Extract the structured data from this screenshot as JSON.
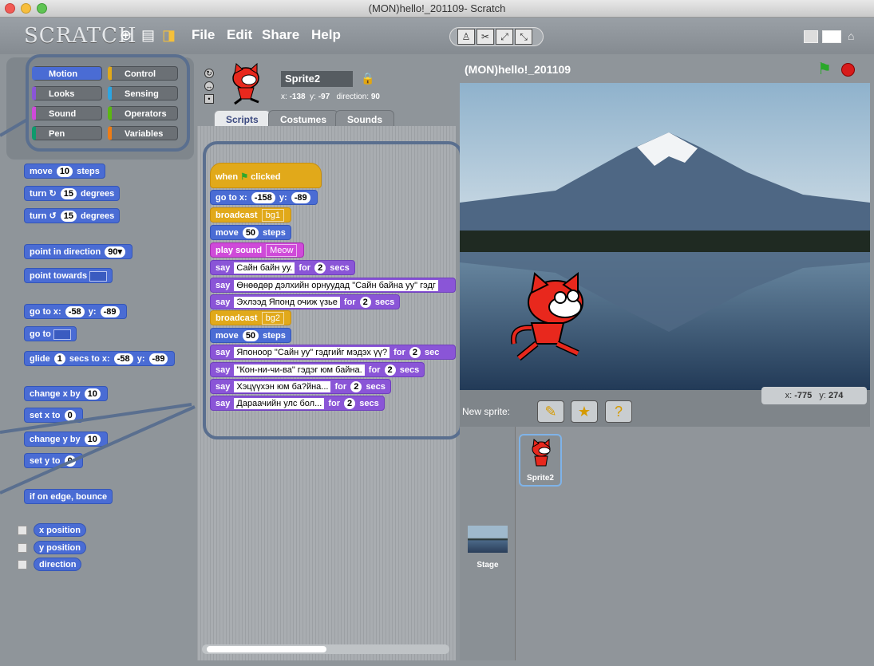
{
  "window": {
    "title": "(MON)hello!_201109- Scratch"
  },
  "menu": {
    "logo": "SCRATCH",
    "items": [
      "File",
      "Edit",
      "Share",
      "Help"
    ]
  },
  "categories": {
    "left": [
      "Motion",
      "Looks",
      "Sound",
      "Pen"
    ],
    "right": [
      "Control",
      "Sensing",
      "Operators",
      "Variables"
    ],
    "colors": {
      "Motion": "#4a6cd4",
      "Looks": "#8a55d7",
      "Sound": "#cf4ad9",
      "Pen": "#0e9a6c",
      "Control": "#e1a91a",
      "Sensing": "#2ca5e2",
      "Operators": "#5cb712",
      "Variables": "#ee7d16"
    }
  },
  "palette": {
    "move": {
      "a": "move",
      "n": "10",
      "b": "steps"
    },
    "turn_cw": {
      "a": "turn ↻",
      "n": "15",
      "b": "degrees"
    },
    "turn_ccw": {
      "a": "turn ↺",
      "n": "15",
      "b": "degrees"
    },
    "point_dir": {
      "a": "point in direction",
      "n": "90▾"
    },
    "point_towards": {
      "a": "point towards"
    },
    "goto_xy": {
      "a": "go to x:",
      "x": "-58",
      "b": "y:",
      "y": "-89"
    },
    "goto": {
      "a": "go to"
    },
    "glide": {
      "a": "glide",
      "s": "1",
      "b": "secs to x:",
      "x": "-58",
      "c": "y:",
      "y": "-89"
    },
    "change_x": {
      "a": "change x by",
      "n": "10"
    },
    "set_x": {
      "a": "set x to",
      "n": "0"
    },
    "change_y": {
      "a": "change y by",
      "n": "10"
    },
    "set_y": {
      "a": "set y to",
      "n": "0"
    },
    "bounce": {
      "a": "if on edge, bounce"
    },
    "reporters": [
      "x position",
      "y position",
      "direction"
    ]
  },
  "sprite": {
    "name": "Sprite2",
    "x_label": "x:",
    "x": "-138",
    "y_label": "y:",
    "y": "-97",
    "dir_label": "direction:",
    "direction": "90"
  },
  "tabs": [
    "Scripts",
    "Costumes",
    "Sounds"
  ],
  "script": {
    "hat": {
      "a": "when",
      "b": "clicked"
    },
    "goto": {
      "a": "go to x:",
      "x": "-158",
      "b": "y:",
      "y": "-89"
    },
    "broadcast1": {
      "a": "broadcast",
      "v": "bg1"
    },
    "move1": {
      "a": "move",
      "n": "50",
      "b": "steps"
    },
    "play": {
      "a": "play sound",
      "v": "Meow"
    },
    "say1": {
      "a": "say",
      "t": "Сайн байн уу.",
      "b": "for",
      "n": "2",
      "c": "secs"
    },
    "say2": {
      "a": "say",
      "t": "Өнөөдөр дэлхийн орнуудад \"Сайн байна уу\" гэдг"
    },
    "say3": {
      "a": "say",
      "t": "Эхлээд Японд очиж үзье",
      "b": "for",
      "n": "2",
      "c": "secs"
    },
    "broadcast2": {
      "a": "broadcast",
      "v": "bg2"
    },
    "move2": {
      "a": "move",
      "n": "50",
      "b": "steps"
    },
    "say4": {
      "a": "say",
      "t": "Японоор \"Сайн уу\" гэдгийг мэдэх үү?",
      "b": "for",
      "n": "2",
      "c": "sec"
    },
    "say5": {
      "a": "say",
      "t": "\"Кон-ни-чи-ва\" гэдэг юм байна.",
      "b": "for",
      "n": "2",
      "c": "secs"
    },
    "say6": {
      "a": "say",
      "t": "Хэцүүхэн юм ба?йна...",
      "b": "for",
      "n": "2",
      "c": "secs"
    },
    "say7": {
      "a": "say",
      "t": "Дараачийн улс бол...",
      "b": "for",
      "n": "2",
      "c": "secs"
    }
  },
  "stage": {
    "title": "(MON)hello!_201109",
    "mouse_x_label": "x:",
    "mouse_x": "-775",
    "mouse_y_label": "y:",
    "mouse_y": "274"
  },
  "new_sprite": {
    "label": "New sprite:"
  },
  "sprites": {
    "sprite_label": "Sprite2",
    "stage_label": "Stage"
  }
}
